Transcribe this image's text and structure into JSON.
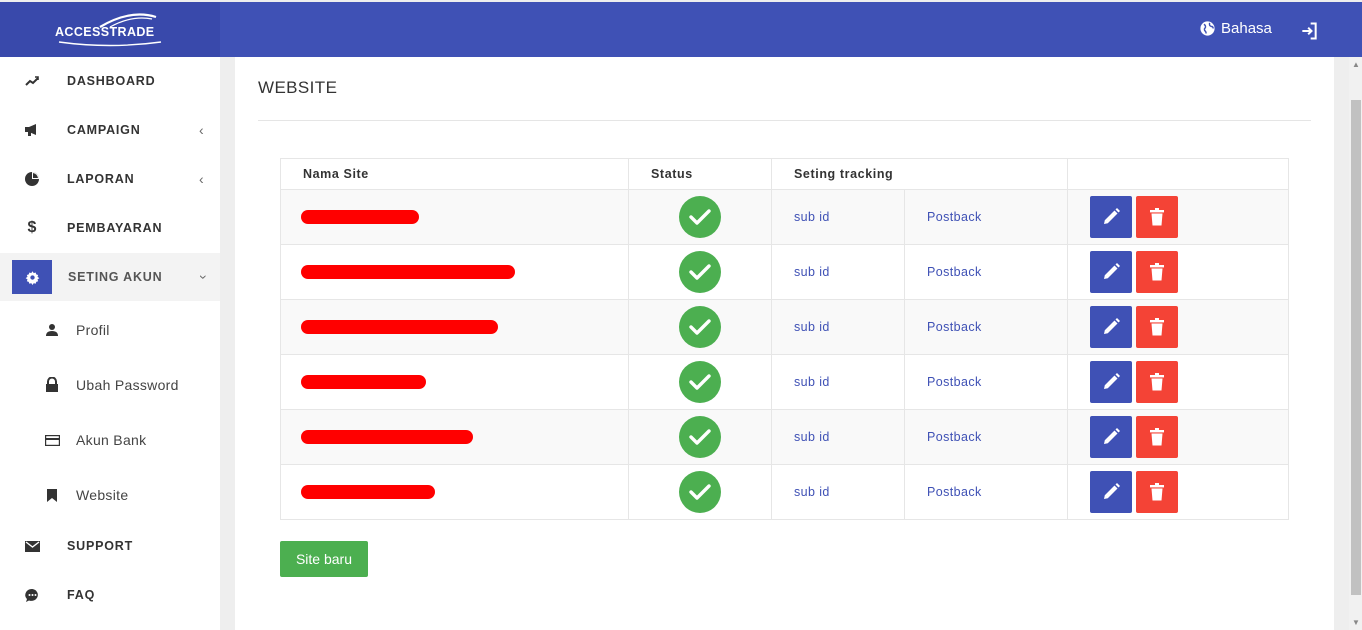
{
  "brand": {
    "logo_text": "ACCESSTRADE"
  },
  "header": {
    "language_label": "Bahasa"
  },
  "sidebar": {
    "items": [
      {
        "label": "DASHBOARD",
        "icon": "trending-up-icon"
      },
      {
        "label": "CAMPAIGN",
        "icon": "megaphone-icon",
        "chevron": "‹"
      },
      {
        "label": "LAPORAN",
        "icon": "pie-chart-icon",
        "chevron": "‹"
      },
      {
        "label": "PEMBAYARAN",
        "icon": "dollar-icon"
      },
      {
        "label": "SETING AKUN",
        "icon": "gear-icon",
        "chevron": "‹",
        "active": true
      },
      {
        "label": "SUPPORT",
        "icon": "mail-icon"
      },
      {
        "label": "FAQ",
        "icon": "chat-bubble-icon"
      }
    ],
    "sub_items": [
      {
        "label": "Profil",
        "icon": "person-icon"
      },
      {
        "label": "Ubah Password",
        "icon": "lock-icon"
      },
      {
        "label": "Akun Bank",
        "icon": "credit-card-icon"
      },
      {
        "label": "Website",
        "icon": "bookmark-icon"
      }
    ]
  },
  "main": {
    "title": "WEBSITE",
    "table": {
      "columns": [
        "Nama Site",
        "Status",
        "Seting tracking",
        ""
      ],
      "rows": [
        {
          "site": "[redacted]",
          "status": "active",
          "subid": "sub id",
          "postback": "Postback"
        },
        {
          "site": "[redacted]",
          "status": "active",
          "subid": "sub id",
          "postback": "Postback"
        },
        {
          "site": "[redacted]",
          "status": "active",
          "subid": "sub id",
          "postback": "Postback"
        },
        {
          "site": "[redacted]",
          "status": "active",
          "subid": "sub id",
          "postback": "Postback"
        },
        {
          "site": "[redacted]",
          "status": "active",
          "subid": "sub id",
          "postback": "Postback"
        },
        {
          "site": "[redacted]",
          "status": "active",
          "subid": "sub id",
          "postback": "Postback"
        }
      ]
    },
    "new_site_button": "Site baru"
  },
  "colors": {
    "primary": "#3f51b5",
    "success": "#4caf50",
    "danger": "#f44336",
    "redaction": "#ff0000"
  }
}
